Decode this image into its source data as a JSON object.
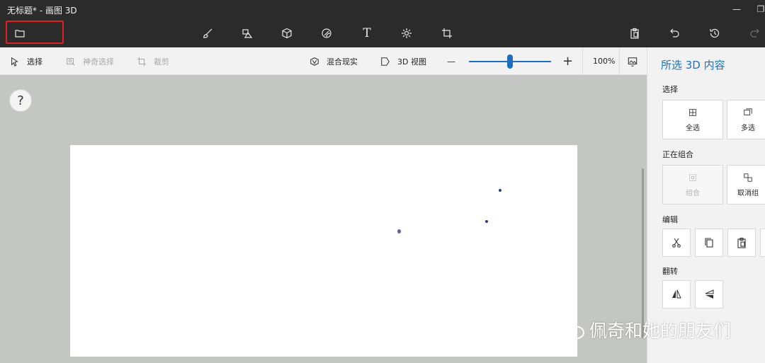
{
  "window": {
    "title": "无标题* - 画图 3D",
    "minimize_glyph": "—",
    "restore_glyph": "❐"
  },
  "toolbar": {
    "items": [
      {
        "name": "menu-icon"
      },
      {
        "name": "brush-icon"
      },
      {
        "name": "2d-shapes-icon"
      },
      {
        "name": "3d-shapes-icon"
      },
      {
        "name": "stickers-icon"
      },
      {
        "name": "text-icon",
        "glyph": "T"
      },
      {
        "name": "effects-icon"
      },
      {
        "name": "canvas-icon"
      },
      {
        "name": "paste-icon"
      },
      {
        "name": "undo-icon"
      },
      {
        "name": "history-icon"
      },
      {
        "name": "redo-icon"
      }
    ]
  },
  "subtoolbar": {
    "select_label": "选择",
    "magic_select_label": "神奇选择",
    "crop_label": "裁剪",
    "mixed_reality_label": "混合现实",
    "view3d_label": "3D 视图",
    "zoom_out_glyph": "—",
    "zoom_in_glyph": "+",
    "zoom_level": "100%",
    "zoom_fraction": 0.5
  },
  "canvas": {
    "help_glyph": "?"
  },
  "panel": {
    "title": "所选 3D 内容",
    "select_section": "选择",
    "select_all_label": "全选",
    "multi_select_label": "多选",
    "group_section": "正在组合",
    "group_label": "组合",
    "ungroup_label": "取消组",
    "edit_section": "编辑",
    "flip_section": "翻转"
  },
  "watermark": {
    "text": "佩奇和她的朋友们"
  },
  "colors": {
    "accent": "#1f6fbf",
    "highlight_box": "#e02020",
    "dark_bar": "#2b2b2b"
  }
}
